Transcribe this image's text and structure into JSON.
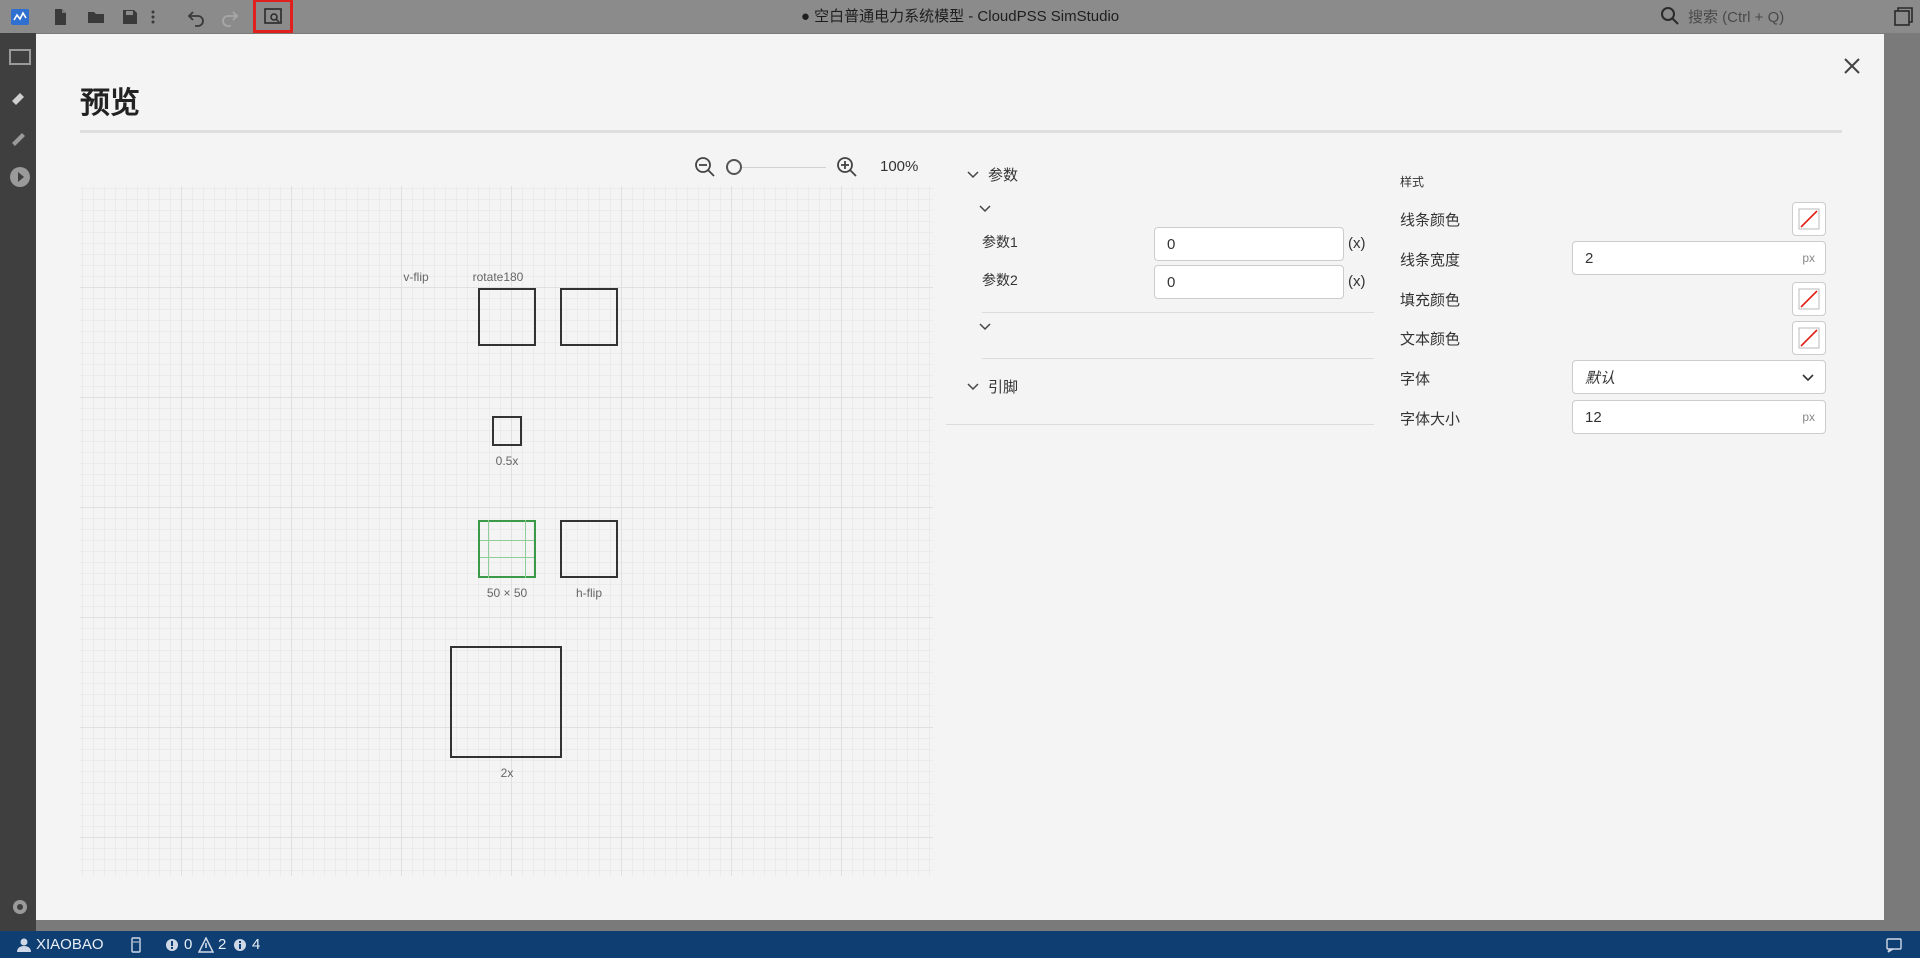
{
  "app": {
    "title": "● 空白普通电力系统模型 - CloudPSS SimStudio",
    "search_placeholder": "搜索 (Ctrl + Q)"
  },
  "toolbar": {
    "icons": [
      "app-logo-icon",
      "new-file-icon",
      "open-folder-icon",
      "save-icon",
      "more-icon",
      "undo-icon",
      "redo-icon",
      "preview-icon"
    ],
    "active": "preview-icon",
    "active_color": "#e0201c"
  },
  "modal": {
    "title": "预览"
  },
  "zoom": {
    "level_label": "100%"
  },
  "canvas": {
    "shapes": [
      {
        "name": "v-flip",
        "label": "v-flip"
      },
      {
        "name": "rotate180",
        "label": "rotate180"
      },
      {
        "name": "half-size",
        "label": "0.5x"
      },
      {
        "name": "selected",
        "label": "50 × 50"
      },
      {
        "name": "h-flip",
        "label": "h-flip"
      },
      {
        "name": "double-size",
        "label": "2x"
      }
    ],
    "selected_color": "#3a9a48"
  },
  "params": {
    "section_label": "参数",
    "fields": [
      {
        "label": "参数1",
        "value": "0",
        "suffix": "(x)"
      },
      {
        "label": "参数2",
        "value": "0",
        "suffix": "(x)"
      }
    ],
    "pins_label": "引脚"
  },
  "style": {
    "title": "样式",
    "line_color_label": "线条颜色",
    "line_width_label": "线条宽度",
    "line_width_value": "2",
    "line_width_unit": "px",
    "fill_color_label": "填充颜色",
    "text_color_label": "文本颜色",
    "font_label": "字体",
    "font_value": "默认",
    "font_size_label": "字体大小",
    "font_size_value": "12",
    "font_size_unit": "px",
    "none_color_stroke": "#e0201c"
  },
  "statusbar": {
    "user": "XIAOBAO",
    "errors": "0",
    "warnings": "2",
    "infos": "4",
    "background": "#0f3e72"
  }
}
